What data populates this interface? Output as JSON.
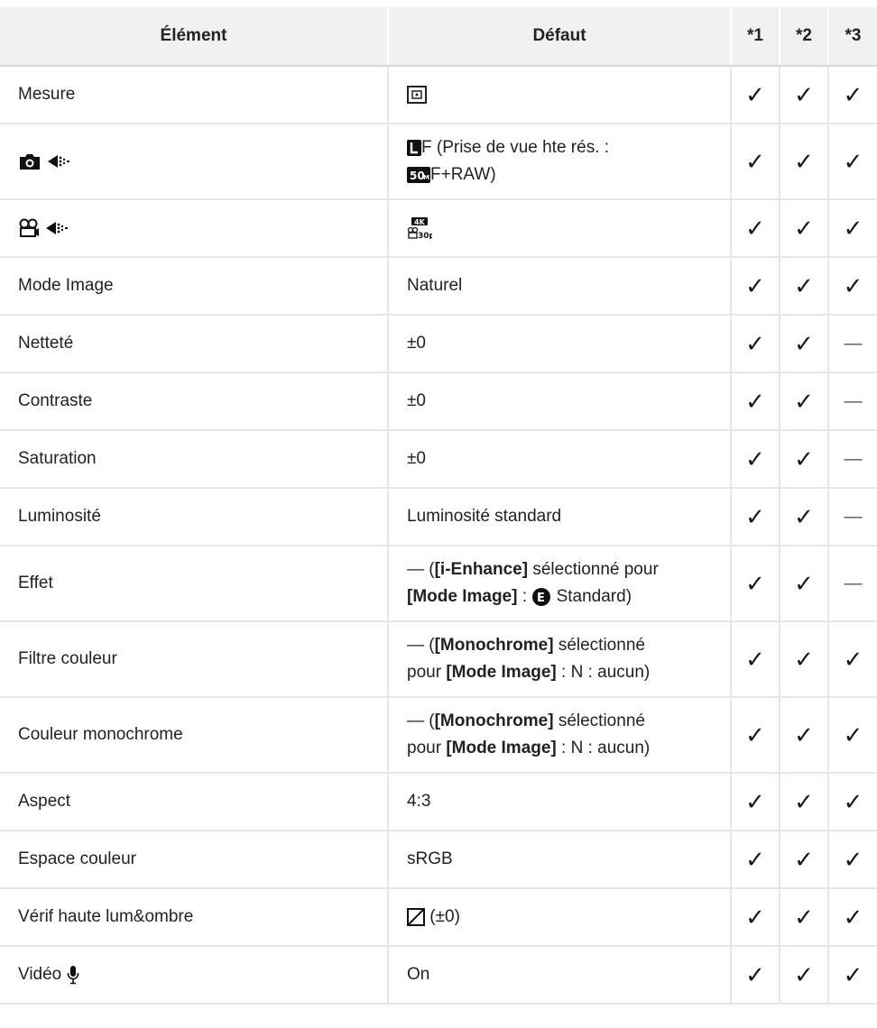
{
  "table": {
    "headers": [
      "Élément",
      "Défaut",
      "*1",
      "*2",
      "*3"
    ],
    "check_symbol": "✓",
    "dash_symbol": "—",
    "rows": [
      {
        "element": "Mesure",
        "default": "",
        "c1": "✓",
        "c2": "✓",
        "c3": "✓"
      },
      {
        "element": "",
        "default_main": "F (Prise de vue hte rés. :",
        "default_tail": "F+RAW)",
        "c1": "✓",
        "c2": "✓",
        "c3": "✓"
      },
      {
        "element": "",
        "default": "",
        "c1": "✓",
        "c2": "✓",
        "c3": "✓"
      },
      {
        "element": "Mode Image",
        "default": "Naturel",
        "c1": "✓",
        "c2": "✓",
        "c3": "✓"
      },
      {
        "element": "Netteté",
        "default": "±0",
        "c1": "✓",
        "c2": "✓",
        "c3": "—"
      },
      {
        "element": "Contraste",
        "default": "±0",
        "c1": "✓",
        "c2": "✓",
        "c3": "—"
      },
      {
        "element": "Saturation",
        "default": "±0",
        "c1": "✓",
        "c2": "✓",
        "c3": "—"
      },
      {
        "element": "Luminosité",
        "default": "Luminosité standard",
        "c1": "✓",
        "c2": "✓",
        "c3": "—"
      },
      {
        "element": "Effet",
        "default_a": "— (",
        "default_b1": "[i-Enhance]",
        "default_c": " sélectionné pour",
        "default_b2": "[Mode Image]",
        "default_d": " : ",
        "default_e": " Standard)",
        "c1": "✓",
        "c2": "✓",
        "c3": "—"
      },
      {
        "element": "Filtre couleur",
        "default_a": "— (",
        "default_b1": "[Monochrome]",
        "default_c": " sélectionné",
        "default_d": "pour ",
        "default_b2": "[Mode Image]",
        "default_e": " : N : aucun)",
        "c1": "✓",
        "c2": "✓",
        "c3": "✓"
      },
      {
        "element": "Couleur monochrome",
        "default_a": "— (",
        "default_b1": "[Monochrome]",
        "default_c": " sélectionné",
        "default_d": "pour ",
        "default_b2": "[Mode Image]",
        "default_e": " : N : aucun)",
        "c1": "✓",
        "c2": "✓",
        "c3": "✓"
      },
      {
        "element": "Aspect",
        "default": "4:3",
        "c1": "✓",
        "c2": "✓",
        "c3": "✓"
      },
      {
        "element": "Espace couleur",
        "default": "sRGB",
        "c1": "✓",
        "c2": "✓",
        "c3": "✓"
      },
      {
        "element": "Vérif haute lum&ombre",
        "default": " (±0)",
        "c1": "✓",
        "c2": "✓",
        "c3": "✓"
      },
      {
        "element": "Vidéo",
        "default": "On",
        "c1": "✓",
        "c2": "✓",
        "c3": "✓"
      }
    ]
  },
  "icons": {
    "row1_default": "metering-icon",
    "row2_element": [
      "camera-icon",
      "image-quality-icon"
    ],
    "row2_default": [
      "large-fine-icon",
      "50m-resolution-icon"
    ],
    "row3_element": [
      "movie-icon",
      "image-quality-icon"
    ],
    "row3_default": "4k-30p-icon",
    "row9_default": "e-circle-icon",
    "row14_default": "exposure-compensation-icon",
    "row15_element": "microphone-icon"
  }
}
